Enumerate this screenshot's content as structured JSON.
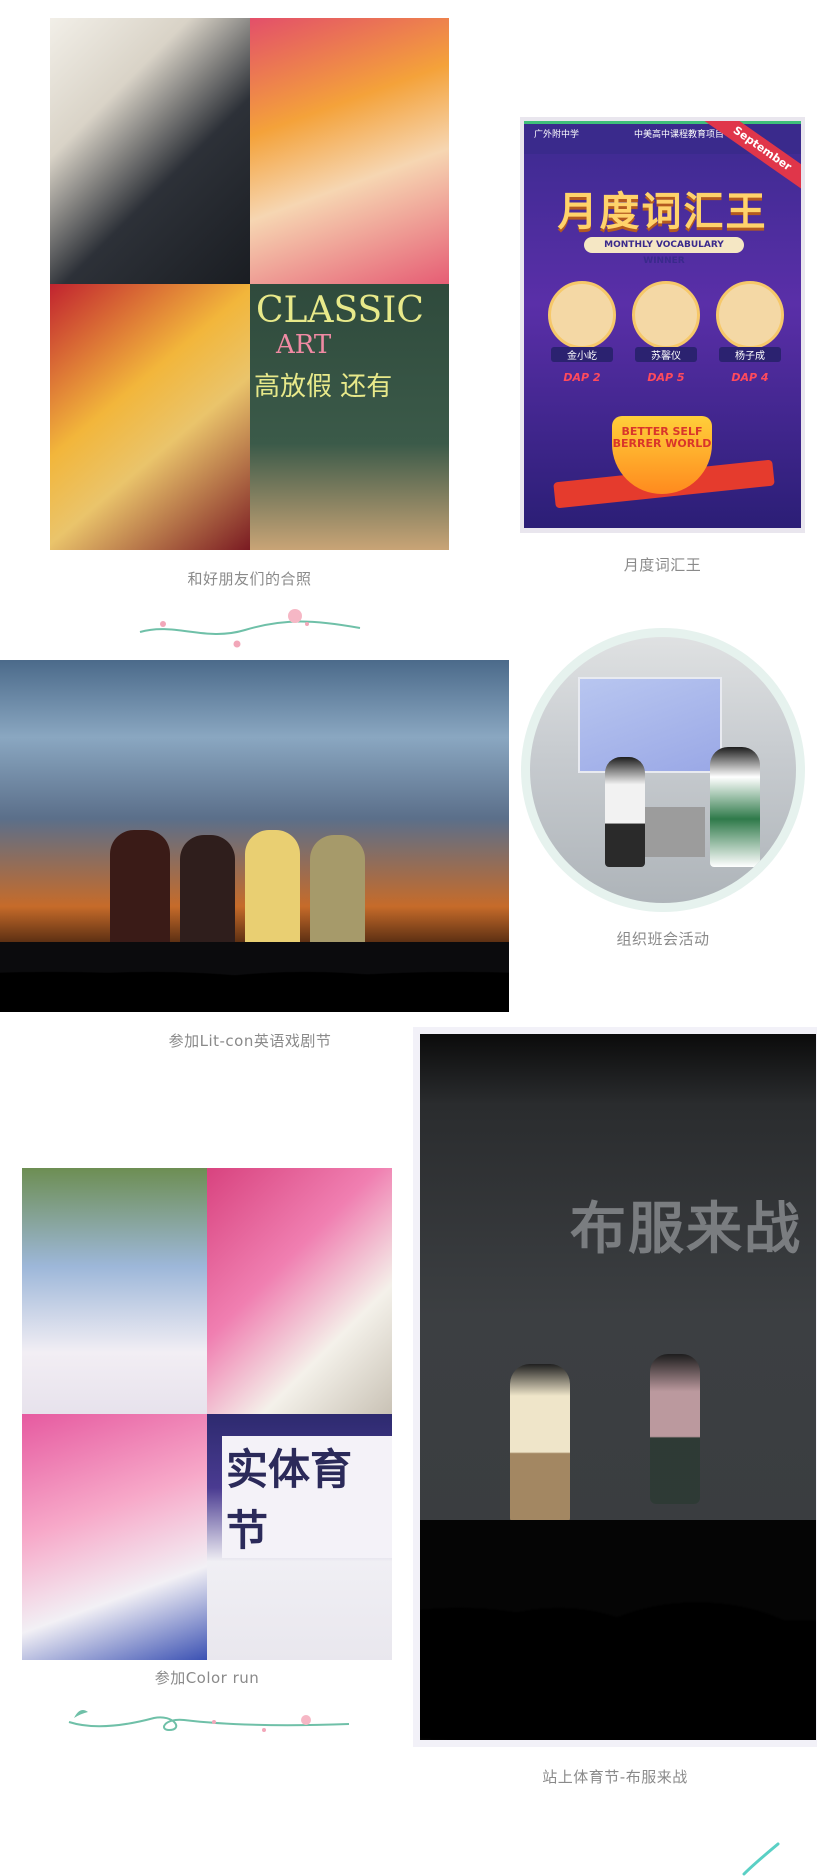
{
  "captions": {
    "friends_photo": "和好朋友们的合照",
    "vocab_king": "月度词汇王",
    "class_meeting": "组织班会活动",
    "litcon": "参加Lit-con英语戏剧节",
    "color_run": "参加Color run",
    "runway": "站上体育节-布服来战"
  },
  "collage1": {
    "chalk_line1": "CLASSIC",
    "chalk_line2": "ART",
    "chalk_line3": "高放假 还有"
  },
  "poster": {
    "school": "广外附中学",
    "program": "中美高中课程教育项目",
    "ribbon": "September",
    "title": "月度词汇王",
    "subtitle": "MONTHLY VOCABULARY WINNER",
    "winners": [
      {
        "name": "金小屹",
        "dap": "DAP 2"
      },
      {
        "name": "苏馨仪",
        "dap": "DAP 5"
      },
      {
        "name": "杨子成",
        "dap": "DAP 4"
      }
    ],
    "trophy_text": "BETTER SELF BERRER WORLD"
  },
  "colorrun": {
    "banner": "实体育节"
  },
  "runway": {
    "sign": "布服来战"
  },
  "colors": {
    "caption": "#8a8a8a",
    "deco_wave": "#6fc0a8",
    "deco_dot": "#f2a7b9"
  }
}
